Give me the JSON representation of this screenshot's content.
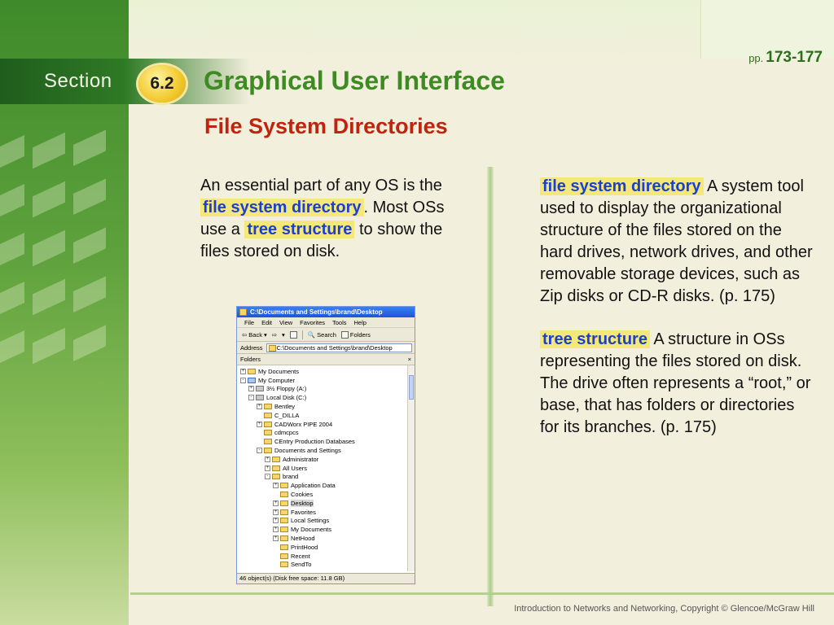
{
  "header": {
    "section_label": "Section",
    "section_number": "6.2",
    "pages_prefix": "pp.",
    "pages": "173-177",
    "title": "Graphical User Interface",
    "subtitle": "File System Directories"
  },
  "left_column": {
    "p1": "An essential part of any OS is the ",
    "term1": "file system directory",
    "p2": ". Most OSs use a ",
    "term2": "tree structure",
    "p3": " to show the files stored on disk."
  },
  "definitions": [
    {
      "term": "file system directory",
      "text": " A system tool used to display the organizational structure of the files stored on the hard drives, network drives, and other removable storage devices, such as Zip disks or CD-R disks. (p. 175)"
    },
    {
      "term": "tree structure",
      "text": " A structure in OSs representing the files stored on disk. The drive often represents a “root,” or base, that has folders or directories for its branches. (p. 175)"
    }
  ],
  "explorer": {
    "title": "C:\\Documents and Settings\\brand\\Desktop",
    "menu": [
      "File",
      "Edit",
      "View",
      "Favorites",
      "Tools",
      "Help"
    ],
    "toolbar": {
      "back": "Back",
      "search": "Search",
      "folders": "Folders"
    },
    "address_label": "Address",
    "address_value": "C:\\Documents and Settings\\brand\\Desktop",
    "folders_label": "Folders",
    "close_glyph": "×",
    "tree": [
      {
        "label": "My Documents",
        "level": 0,
        "toggle": "+"
      },
      {
        "label": "My Computer",
        "level": 0,
        "toggle": "-"
      },
      {
        "label": "3½ Floppy (A:)",
        "level": 1,
        "toggle": "+"
      },
      {
        "label": "Local Disk (C:)",
        "level": 1,
        "toggle": "-"
      },
      {
        "label": "Bentley",
        "level": 2,
        "toggle": "+"
      },
      {
        "label": "C_DILLA",
        "level": 2,
        "toggle": ""
      },
      {
        "label": "CADWorx PIPE 2004",
        "level": 2,
        "toggle": "+"
      },
      {
        "label": "cdmcpcs",
        "level": 2,
        "toggle": ""
      },
      {
        "label": "CEntry Production Databases",
        "level": 2,
        "toggle": ""
      },
      {
        "label": "Documents and Settings",
        "level": 2,
        "toggle": "-"
      },
      {
        "label": "Administrator",
        "level": 3,
        "toggle": "+"
      },
      {
        "label": "All Users",
        "level": 3,
        "toggle": "+"
      },
      {
        "label": "brand",
        "level": 3,
        "toggle": "-"
      },
      {
        "label": "Application Data",
        "level": 4,
        "toggle": "+"
      },
      {
        "label": "Cookies",
        "level": 4,
        "toggle": ""
      },
      {
        "label": "Desktop",
        "level": 4,
        "toggle": "+"
      },
      {
        "label": "Favorites",
        "level": 4,
        "toggle": "+"
      },
      {
        "label": "Local Settings",
        "level": 4,
        "toggle": "+"
      },
      {
        "label": "My Documents",
        "level": 4,
        "toggle": "+"
      },
      {
        "label": "NetHood",
        "level": 4,
        "toggle": "+"
      },
      {
        "label": "PrintHood",
        "level": 4,
        "toggle": ""
      },
      {
        "label": "Recent",
        "level": 4,
        "toggle": ""
      },
      {
        "label": "SendTo",
        "level": 4,
        "toggle": ""
      }
    ],
    "status": "46 object(s) (Disk free space: 11.8 GB)"
  },
  "footer": "Introduction to Networks and Networking, Copyright © Glencoe/McGraw Hill",
  "colors": {
    "title_green": "#3e8b24",
    "subtitle_red": "#c0240d",
    "term_blue": "#1b3fcf",
    "term_highlight": "#f5e87a"
  }
}
